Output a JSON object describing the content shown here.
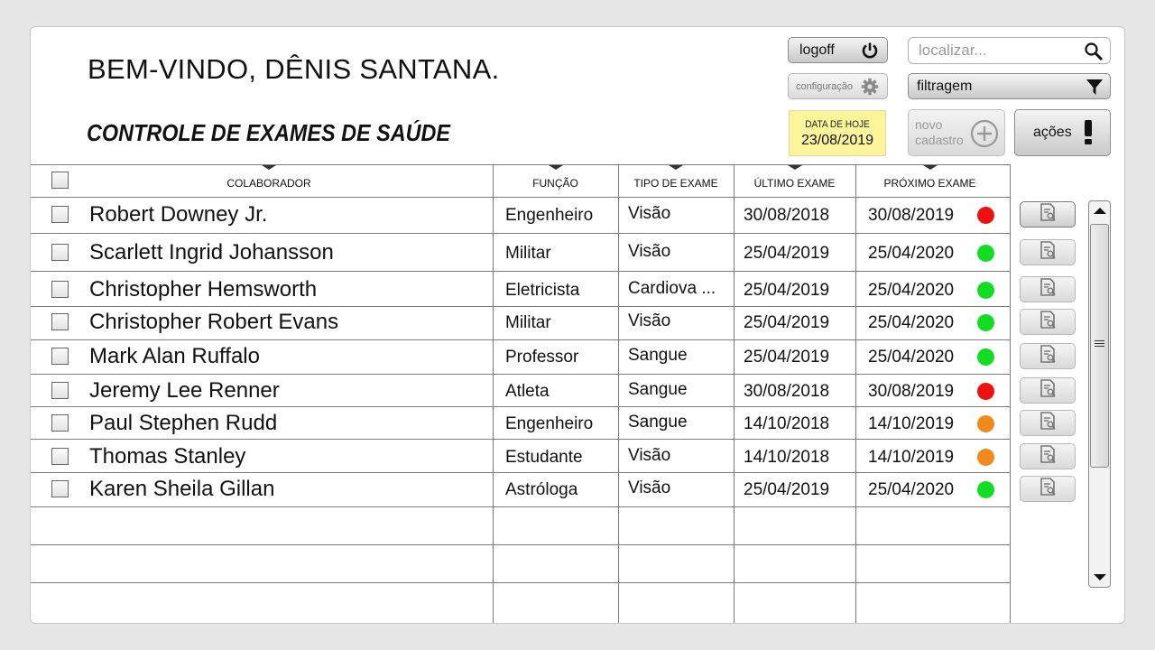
{
  "header": {
    "welcome": "BEM-VINDO, DÊNIS SANTANA.",
    "subtitle": "CONTROLE DE EXAMES DE SAÚDE",
    "logoff_label": "logoff",
    "config_label": "configuração",
    "search_placeholder": "localizar...",
    "filter_label": "filtragem",
    "date_label": "DATA DE HOJE",
    "date_value": "23/08/2019",
    "new_label_1": "novo",
    "new_label_2": "cadastro",
    "actions_label": "ações"
  },
  "table": {
    "columns": [
      "COLABORADOR",
      "FUNÇÃO",
      "TIPO DE EXAME",
      "ÚLTIMO EXAME",
      "PRÓXIMO EXAME"
    ],
    "rows": [
      {
        "name": "Robert Downey Jr.",
        "funcao": "Engenheiro",
        "tipo": "Visão",
        "ultimo": "30/08/2018",
        "proximo": "30/08/2019",
        "status": "red"
      },
      {
        "name": "Scarlett Ingrid Johansson",
        "funcao": "Militar",
        "tipo": "Visão",
        "ultimo": "25/04/2019",
        "proximo": "25/04/2020",
        "status": "green"
      },
      {
        "name": "Christopher Hemsworth",
        "funcao": "Eletricista",
        "tipo": "Cardiova ...",
        "ultimo": "25/04/2019",
        "proximo": "25/04/2020",
        "status": "green"
      },
      {
        "name": "Christopher Robert Evans",
        "funcao": "Militar",
        "tipo": "Visão",
        "ultimo": "25/04/2019",
        "proximo": "25/04/2020",
        "status": "green"
      },
      {
        "name": "Mark Alan Ruffalo",
        "funcao": "Professor",
        "tipo": "Sangue",
        "ultimo": "25/04/2019",
        "proximo": "25/04/2020",
        "status": "green"
      },
      {
        "name": "Jeremy Lee Renner",
        "funcao": "Atleta",
        "tipo": "Sangue",
        "ultimo": "30/08/2018",
        "proximo": "30/08/2019",
        "status": "red"
      },
      {
        "name": "Paul Stephen Rudd",
        "funcao": "Engenheiro",
        "tipo": "Sangue",
        "ultimo": "14/10/2018",
        "proximo": "14/10/2019",
        "status": "orange"
      },
      {
        "name": "Thomas Stanley",
        "funcao": "Estudante",
        "tipo": "Visão",
        "ultimo": "14/10/2018",
        "proximo": "14/10/2019",
        "status": "orange"
      },
      {
        "name": "Karen Sheila Gillan",
        "funcao": "Astróloga",
        "tipo": "Visão",
        "ultimo": "25/04/2019",
        "proximo": "25/04/2020",
        "status": "green"
      }
    ]
  },
  "colors": {
    "red": "#ee1111",
    "green": "#11dd22",
    "orange": "#f18a1c",
    "date_bg": "#fdf59a"
  },
  "icons": {
    "logoff": "power-icon",
    "config": "gear-icon",
    "search": "magnifier-icon",
    "filter": "funnel-icon",
    "new": "plus-circle-icon",
    "actions": "exclamation-icon",
    "row_view": "document-search-icon"
  }
}
